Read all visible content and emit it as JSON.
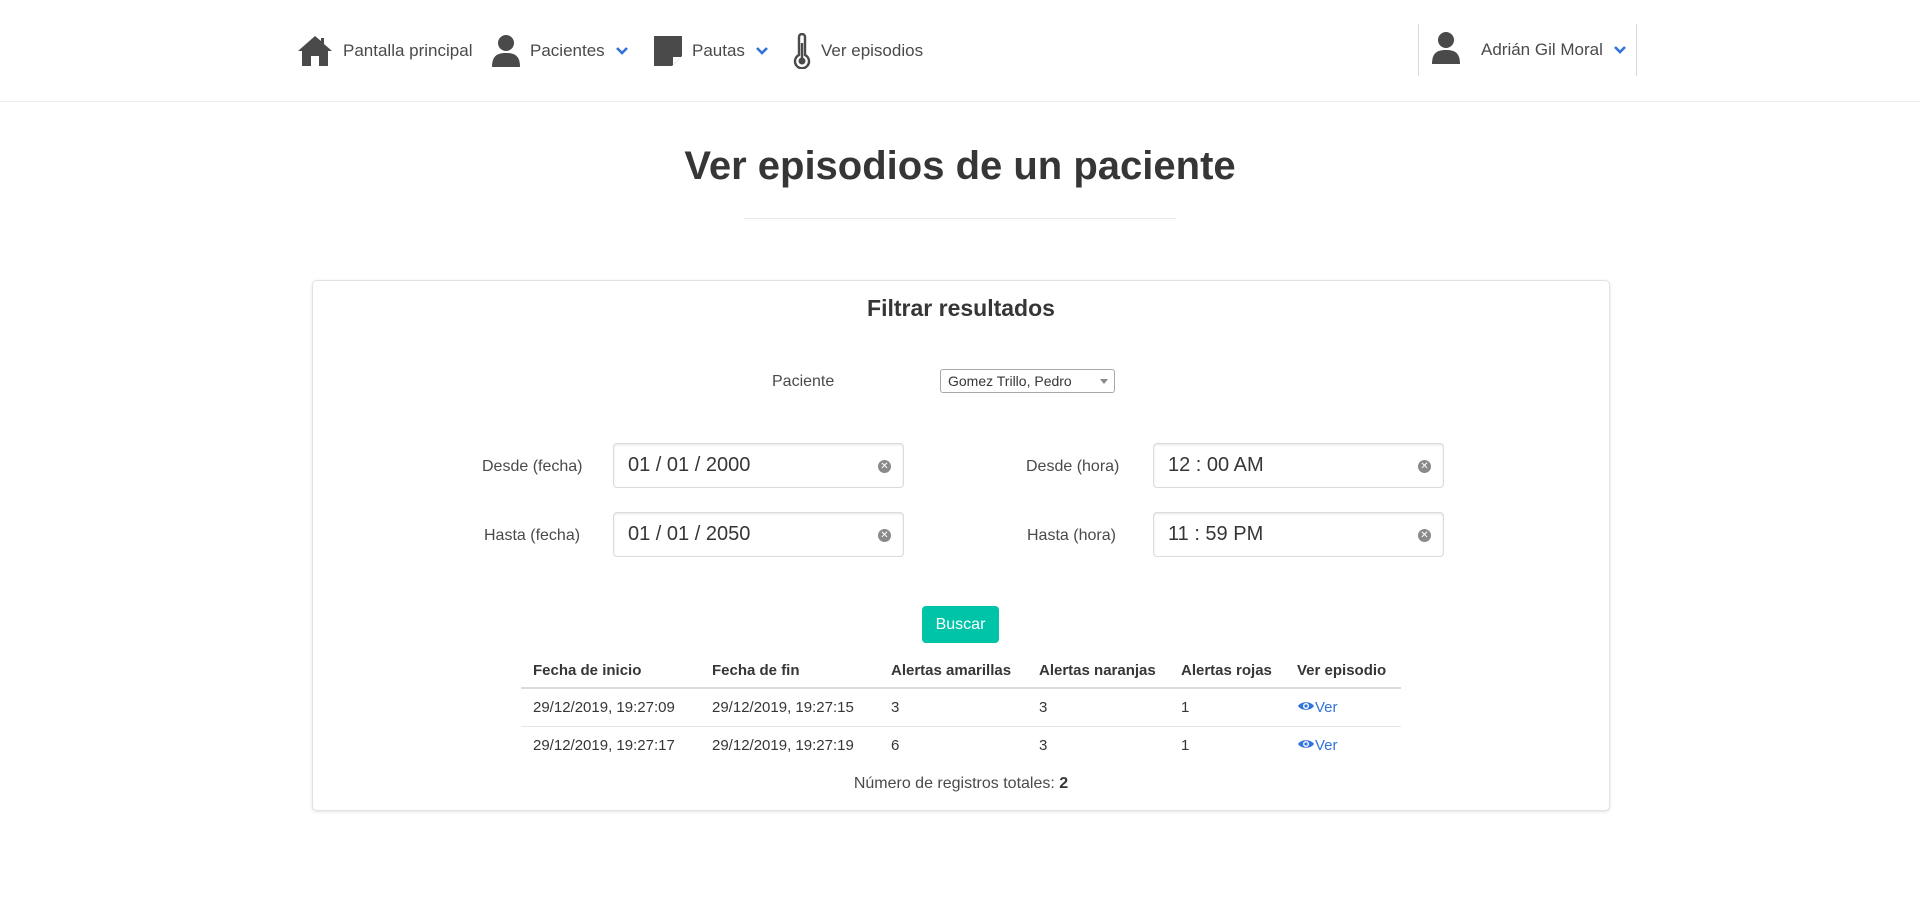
{
  "nav": {
    "home_label": "Pantalla principal",
    "patients_label": "Pacientes",
    "guidelines_label": "Pautas",
    "episodes_label": "Ver episodios",
    "user_name": "Adrián Gil Moral"
  },
  "page": {
    "title": "Ver episodios de un paciente"
  },
  "filter": {
    "title": "Filtrar resultados",
    "patient_label": "Paciente",
    "patient_value": "Gomez Trillo, Pedro",
    "from_date_label": "Desde (fecha)",
    "from_date_value": "01 / 01 / 2000",
    "to_date_label": "Hasta (fecha)",
    "to_date_value": "01 / 01 / 2050",
    "from_time_label": "Desde (hora)",
    "from_time_value": "12 : 00  AM",
    "to_time_label": "Hasta (hora)",
    "to_time_value": "11 : 59  PM",
    "search_label": "Buscar"
  },
  "table": {
    "headers": [
      "Fecha de inicio",
      "Fecha de fin",
      "Alertas amarillas",
      "Alertas naranjas",
      "Alertas rojas",
      "Ver episodio"
    ],
    "rows": [
      [
        "29/12/2019, 19:27:09",
        "29/12/2019, 19:27:15",
        "3",
        "3",
        "1",
        "Ver"
      ],
      [
        "29/12/2019, 19:27:17",
        "29/12/2019, 19:27:19",
        "6",
        "3",
        "1",
        "Ver"
      ]
    ],
    "totals_label": "Número de registros totales:",
    "totals_value": "2"
  },
  "colors": {
    "primary": "#00c4a7",
    "link": "#3273dc",
    "text": "#363636",
    "icon": "#4a4a4a"
  },
  "icons": [
    "home-icon",
    "user-icon",
    "note-icon",
    "thermometer-icon",
    "chevron-down-icon",
    "eye-icon",
    "clear-icon"
  ]
}
